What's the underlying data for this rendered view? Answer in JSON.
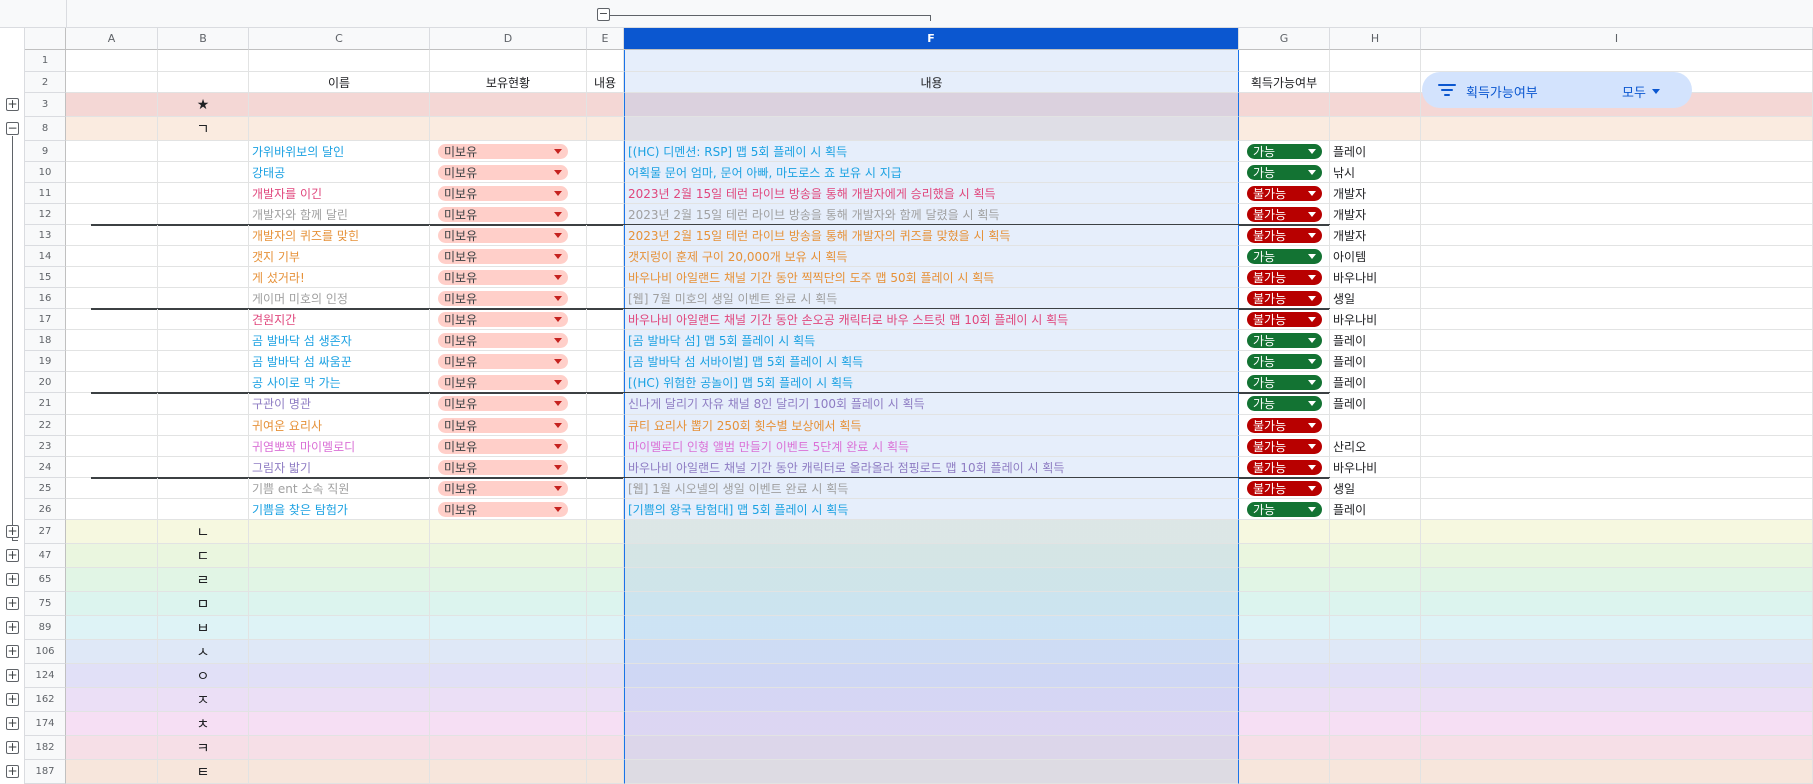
{
  "columns": [
    "A",
    "B",
    "C",
    "D",
    "E",
    "F",
    "G",
    "H",
    "I"
  ],
  "headers": {
    "name": "이름",
    "own": "보유현황",
    "e": "내용",
    "f": "내용",
    "g": "획득가능여부"
  },
  "filter": {
    "label": "획득가능여부",
    "value": "모두"
  },
  "group_controls": {
    "expand": "+",
    "collapse": "−"
  },
  "colors": {
    "selected_col_header": "#0b57d0",
    "available": "#137333",
    "unavailable": "#b80000",
    "not_owned_chip": "#ffcfc9",
    "filter_chip": "#d3e3fd"
  },
  "rows": [
    {
      "num": "1"
    },
    {
      "num": "2"
    },
    {
      "num": "3",
      "section": "★"
    },
    {
      "num": "8",
      "section": "ㄱ"
    },
    {
      "num": "9",
      "name": "가위바위보의 달인",
      "color": "#1ba1e2",
      "owned": "미보유",
      "desc": "[(HC) 디멘션: RSP] 맵 5회 플레이 시 획득",
      "avail": "가능",
      "cat": "플레이"
    },
    {
      "num": "10",
      "name": "강태공",
      "color": "#1ba1e2",
      "owned": "미보유",
      "desc": "어획물 문어 엄마, 문어 아빠, 마도로스 죠 보유 시 지급",
      "avail": "가능",
      "cat": "낚시"
    },
    {
      "num": "11",
      "name": "개발자를 이긴",
      "color": "#e0467c",
      "owned": "미보유",
      "desc": "2023년 2월 15일 테런 라이브 방송을 통해 개발자에게 승리했을 시 획득",
      "avail": "불가능",
      "cat": "개발자"
    },
    {
      "num": "12",
      "name": "개발자와 함께 달린",
      "color": "#a0a0a0",
      "owned": "미보유",
      "desc": "2023년 2월 15일 테런 라이브 방송을 통해 개발자와 함께 달렸을 시 획득",
      "avail": "불가능",
      "cat": "개발자"
    },
    {
      "num": "13",
      "name": "개발자의 퀴즈를 맞힌",
      "color": "#e69138",
      "owned": "미보유",
      "desc": "2023년 2월 15일 테런 라이브 방송을 통해 개발자의 퀴즈를 맞혔을 시 획득",
      "avail": "불가능",
      "cat": "개발자"
    },
    {
      "num": "14",
      "name": "갯지 기부",
      "color": "#e69138",
      "owned": "미보유",
      "desc": "갯지렁이 훈제 구이 20,000개 보유 시 획득",
      "avail": "가능",
      "cat": "아이템"
    },
    {
      "num": "15",
      "name": "게 섰거라!",
      "color": "#e69138",
      "owned": "미보유",
      "desc": "바우나비 아일랜드 채널 기간 동안 찍찍단의 도주 맵 50회 플레이 시 획득",
      "avail": "불가능",
      "cat": "바우나비"
    },
    {
      "num": "16",
      "name": "게이머 미호의 인정",
      "color": "#a0a0a0",
      "owned": "미보유",
      "desc": "[웹] 7월 미호의 생일 이벤트 완료 시 획득",
      "avail": "불가능",
      "cat": "생일"
    },
    {
      "num": "17",
      "name": "견원지간",
      "color": "#e0467c",
      "owned": "미보유",
      "desc": "바우나비 아일랜드 채널 기간 동안 손오공 캐릭터로 바우 스트릿 맵 10회 플레이 시 획득",
      "avail": "불가능",
      "cat": "바우나비"
    },
    {
      "num": "18",
      "name": "곰 발바닥 섬 생존자",
      "color": "#1ba1e2",
      "owned": "미보유",
      "desc": "[곰 발바닥 섬] 맵 5회 플레이 시 획득",
      "avail": "가능",
      "cat": "플레이"
    },
    {
      "num": "19",
      "name": "곰 발바닥 섬 싸움꾼",
      "color": "#1ba1e2",
      "owned": "미보유",
      "desc": "[곰 발바닥 섬 서바이벌] 맵 5회 플레이 시 획득",
      "avail": "가능",
      "cat": "플레이"
    },
    {
      "num": "20",
      "name": "공 사이로 막 가는",
      "color": "#1ba1e2",
      "owned": "미보유",
      "desc": "[(HC) 위험한 공놀이] 맵 5회 플레이 시 획득",
      "avail": "가능",
      "cat": "플레이"
    },
    {
      "num": "21",
      "name": "구관이 명관",
      "color": "#8e7cc3",
      "owned": "미보유",
      "desc": "신나게 달리기 자유 채널 8인 달리기 100회 플레이 시 획득",
      "avail": "가능",
      "cat": "플레이"
    },
    {
      "num": "22",
      "name": "귀여운 요리사",
      "color": "#e69138",
      "owned": "미보유",
      "desc": "큐티 요리사 뽑기 250회 횟수별 보상에서 획득",
      "avail": "불가능",
      "cat": ""
    },
    {
      "num": "23",
      "name": "귀염뽀짝 마이멜로디",
      "color": "#da70d6",
      "owned": "미보유",
      "desc": "마이멜로디 인형 앨범 만들기 이벤트 5단계 완료 시 획득",
      "avail": "불가능",
      "cat": "산리오"
    },
    {
      "num": "24",
      "name": "그림자 밟기",
      "color": "#8e7cc3",
      "owned": "미보유",
      "desc": "바우나비 아일랜드 채널 기간 동안 캐릭터로 올라올라 점핑로드 맵 10회 플레이 시 획득",
      "avail": "불가능",
      "cat": "바우나비"
    },
    {
      "num": "25",
      "name": "기쁨 ent 소속 직원",
      "color": "#a0a0a0",
      "owned": "미보유",
      "desc": "[웹] 1월 시오넬의 생일 이벤트 완료 시 획득",
      "avail": "불가능",
      "cat": "생일"
    },
    {
      "num": "26",
      "name": "기쁨을 찾은 탐험가",
      "color": "#1ba1e2",
      "owned": "미보유",
      "desc": "[기쁨의 왕국 탐험대] 맵 5회 플레이 시 획득",
      "avail": "가능",
      "cat": "플레이"
    },
    {
      "num": "27",
      "section": "ㄴ"
    },
    {
      "num": "47",
      "section": "ㄷ"
    },
    {
      "num": "65",
      "section": "ㄹ"
    },
    {
      "num": "75",
      "section": "ㅁ"
    },
    {
      "num": "89",
      "section": "ㅂ"
    },
    {
      "num": "106",
      "section": "ㅅ"
    },
    {
      "num": "124",
      "section": "ㅇ"
    },
    {
      "num": "162",
      "section": "ㅈ"
    },
    {
      "num": "174",
      "section": "ㅊ"
    },
    {
      "num": "182",
      "section": "ㅋ"
    },
    {
      "num": "187",
      "section": "ㅌ"
    }
  ]
}
